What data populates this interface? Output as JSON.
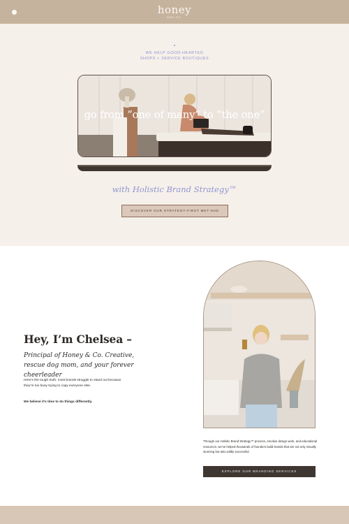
{
  "header": {
    "logo_text": "honey",
    "logo_subtext": "AND CO.",
    "menu_icon": "menu-dot-icon",
    "background": "#c6b39e"
  },
  "hero": {
    "kicker_line1": "WE HELP GOOD-HEARTED",
    "kicker_line2": "SHOPS + SERVICE BOUTIQUES",
    "headline": "go from “one of many” to “the one”",
    "subheadline": "with Holistic Brand Strategy™",
    "cta_label": "DISCOVER OUR STRATEGY-FIRST MET-H0D",
    "accent_color": "#8f95d0",
    "background": "#f6f0ea"
  },
  "about": {
    "title": "Hey, I’m Chelsea –",
    "role": "Principal of Honey & Co. Creative, rescue dog mom, and your forever cheerleader",
    "intro": "Here’s the tough truth: most brands struggle to stand out because they’re too busy trying to copy everyone else.",
    "emphasis": "We believe it’s time to do things differently.",
    "process_text": "Through our Holistic Brand Strategy™ process, emotive design work, and educational resources, we’ve helped thousands of founders build brands that are not only visually stunning but also wildly successful.",
    "cta_label": "EXPLORE OUR BRANDING SERVICES"
  },
  "footer": {
    "background": "#d8c6b7"
  }
}
